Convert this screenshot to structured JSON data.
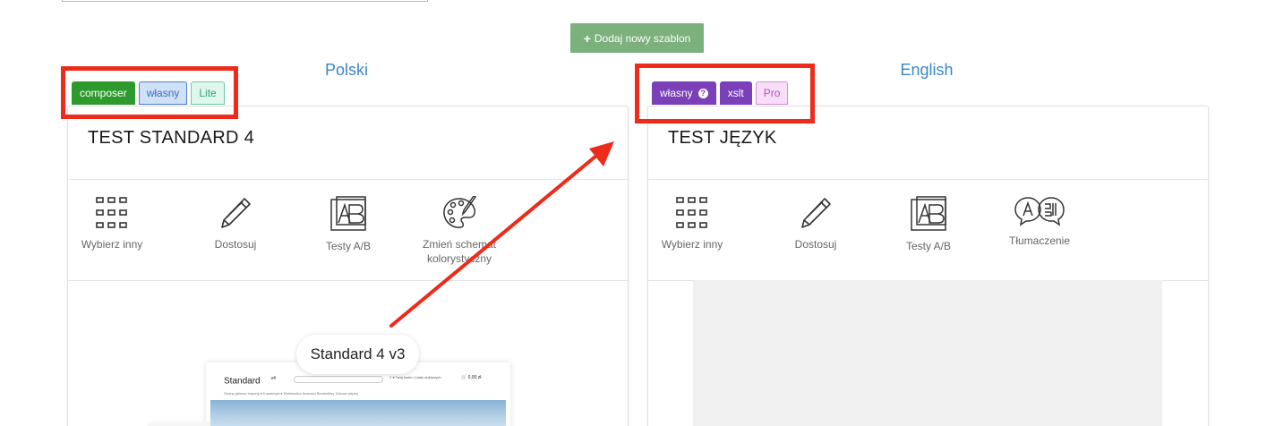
{
  "add_template_button": {
    "label": "Dodaj nowy szablon"
  },
  "panels": [
    {
      "language": "Polski",
      "badges": [
        "composer",
        "własny",
        "Lite"
      ],
      "title": "TEST STANDARD 4",
      "actions": [
        "Wybierz inny",
        "Dostosuj",
        "Testy A/B",
        "Zmień schemat kolorystyczny"
      ],
      "preview": {
        "tooltip": "Standard 4 v3",
        "logo": "Standard",
        "logo_sup": "v4",
        "header_right": "≡ ▾   Twój konto  |  Lista ulubionych",
        "price": "🛒  0,00 zł",
        "nav": "Strony główna   Importy ▾   Kosmetyki ▾   Elektronika   Nowości   Bestsellery   Zobacz więcej"
      }
    },
    {
      "language": "English",
      "badges": [
        "własny",
        "xslt",
        "Pro"
      ],
      "title": "TEST JĘZYK",
      "actions": [
        "Wybierz inny",
        "Dostosuj",
        "Testy A/B",
        "Tłumaczenie"
      ]
    }
  ],
  "icons": {
    "grid": "grid-icon",
    "pencil": "pencil-icon",
    "ab": "ab-test-icon",
    "palette": "palette-icon",
    "translate": "translate-icon",
    "plus": "plus-icon",
    "help": "question-icon"
  },
  "colors": {
    "add_button": "#7cb07c",
    "language_link": "#3a86c8",
    "composer": "#2e9a2e",
    "own_purple": "#7b3fb8",
    "highlight_red": "#ee2a1a"
  }
}
